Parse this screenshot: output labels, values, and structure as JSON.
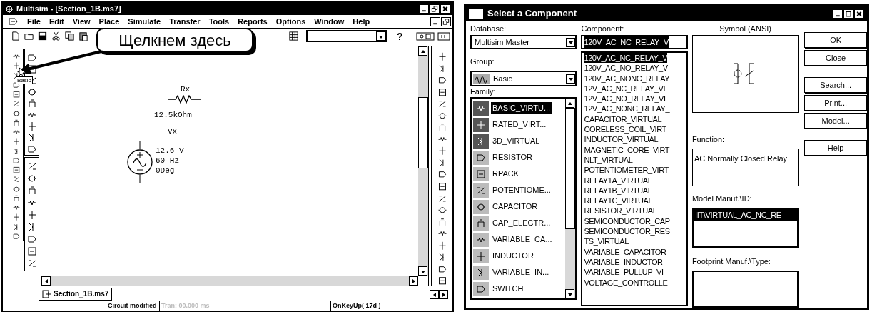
{
  "main_window": {
    "title": "Multisim - [Section_1B.ms7]",
    "menu": [
      "File",
      "Edit",
      "View",
      "Place",
      "Simulate",
      "Transfer",
      "Tools",
      "Reports",
      "Options",
      "Window",
      "Help"
    ],
    "help_button": "?",
    "callout": "Щелкнем здесь",
    "tooltip": "Basic",
    "schematic": {
      "resistor_name": "Rx",
      "resistor_value": "12.5kOhm",
      "source_name": "Vx",
      "source_values": [
        "12.6 V",
        "60 Hz",
        "0Deg"
      ]
    },
    "tab": "Section_1B.ms7",
    "status_bar": [
      {
        "text": "Circuit modified",
        "disabled": false
      },
      {
        "text": "Tran: 00.000 ms",
        "disabled": true
      },
      {
        "text": "OnKeyUp( 17d )",
        "disabled": false
      }
    ]
  },
  "dialog": {
    "title": "Select a Component",
    "database": {
      "label": "Database:",
      "value": "Multisim Master"
    },
    "group": {
      "label": "Group:",
      "value": "Basic"
    },
    "family": {
      "label": "Family:",
      "items": [
        {
          "label": "BASIC_VIRTU...",
          "kind": "virtual",
          "selected": true
        },
        {
          "label": "RATED_VIRT...",
          "kind": "virtual",
          "selected": false
        },
        {
          "label": "3D_VIRTUAL",
          "kind": "virtual",
          "selected": false
        },
        {
          "label": "RESISTOR",
          "kind": "real",
          "selected": false
        },
        {
          "label": "RPACK",
          "kind": "real",
          "selected": false
        },
        {
          "label": "POTENTIOME...",
          "kind": "real",
          "selected": false
        },
        {
          "label": "CAPACITOR",
          "kind": "real",
          "selected": false
        },
        {
          "label": "CAP_ELECTR...",
          "kind": "real",
          "selected": false
        },
        {
          "label": "VARIABLE_CA...",
          "kind": "real",
          "selected": false
        },
        {
          "label": "INDUCTOR",
          "kind": "real",
          "selected": false
        },
        {
          "label": "VARIABLE_IN...",
          "kind": "real",
          "selected": false
        },
        {
          "label": "SWITCH",
          "kind": "real",
          "selected": false
        }
      ]
    },
    "component": {
      "label": "Component:",
      "value": "120V_AC_NC_RELAY_V",
      "items": [
        {
          "label": "120V_AC_NC_RELAY_V",
          "selected": true
        },
        {
          "label": "120V_AC_NO_RELAY_V",
          "selected": false
        },
        {
          "label": "120V_AC_NONC_RELAY",
          "selected": false
        },
        {
          "label": "12V_AC_NC_RELAY_VI",
          "selected": false
        },
        {
          "label": "12V_AC_NO_RELAY_VI",
          "selected": false
        },
        {
          "label": "12V_AC_NONC_RELAY_",
          "selected": false
        },
        {
          "label": "CAPACITOR_VIRTUAL",
          "selected": false
        },
        {
          "label": "CORELESS_COIL_VIRT",
          "selected": false
        },
        {
          "label": "INDUCTOR_VIRTUAL",
          "selected": false
        },
        {
          "label": "MAGNETIC_CORE_VIRT",
          "selected": false
        },
        {
          "label": "NLT_VIRTUAL",
          "selected": false
        },
        {
          "label": "POTENTIOMETER_VIRT",
          "selected": false
        },
        {
          "label": "RELAY1A_VIRTUAL",
          "selected": false
        },
        {
          "label": "RELAY1B_VIRTUAL",
          "selected": false
        },
        {
          "label": "RELAY1C_VIRTUAL",
          "selected": false
        },
        {
          "label": "RESISTOR_VIRTUAL",
          "selected": false
        },
        {
          "label": "SEMICONDUCTOR_CAP",
          "selected": false
        },
        {
          "label": "SEMICONDUCTOR_RES",
          "selected": false
        },
        {
          "label": "TS_VIRTUAL",
          "selected": false
        },
        {
          "label": "VARIABLE_CAPACITOR_",
          "selected": false
        },
        {
          "label": "VARIABLE_INDUCTOR_",
          "selected": false
        },
        {
          "label": "VARIABLE_PULLUP_VI",
          "selected": false
        },
        {
          "label": "VOLTAGE_CONTROLLE",
          "selected": false
        }
      ]
    },
    "symbol": {
      "label": "Symbol (ANSI)"
    },
    "function": {
      "label": "Function:",
      "value": "AC Normally Closed Relay"
    },
    "model": {
      "label": "Model Manuf.\\ID:",
      "items": [
        {
          "label": "IIT\\VIRTUAL_AC_NC_RE",
          "selected": true
        }
      ]
    },
    "footprint": {
      "label": "Footprint Manuf.\\Type:"
    },
    "buttons": [
      "OK",
      "Close",
      "Search...",
      "Print...",
      "Model...",
      "Help"
    ]
  }
}
